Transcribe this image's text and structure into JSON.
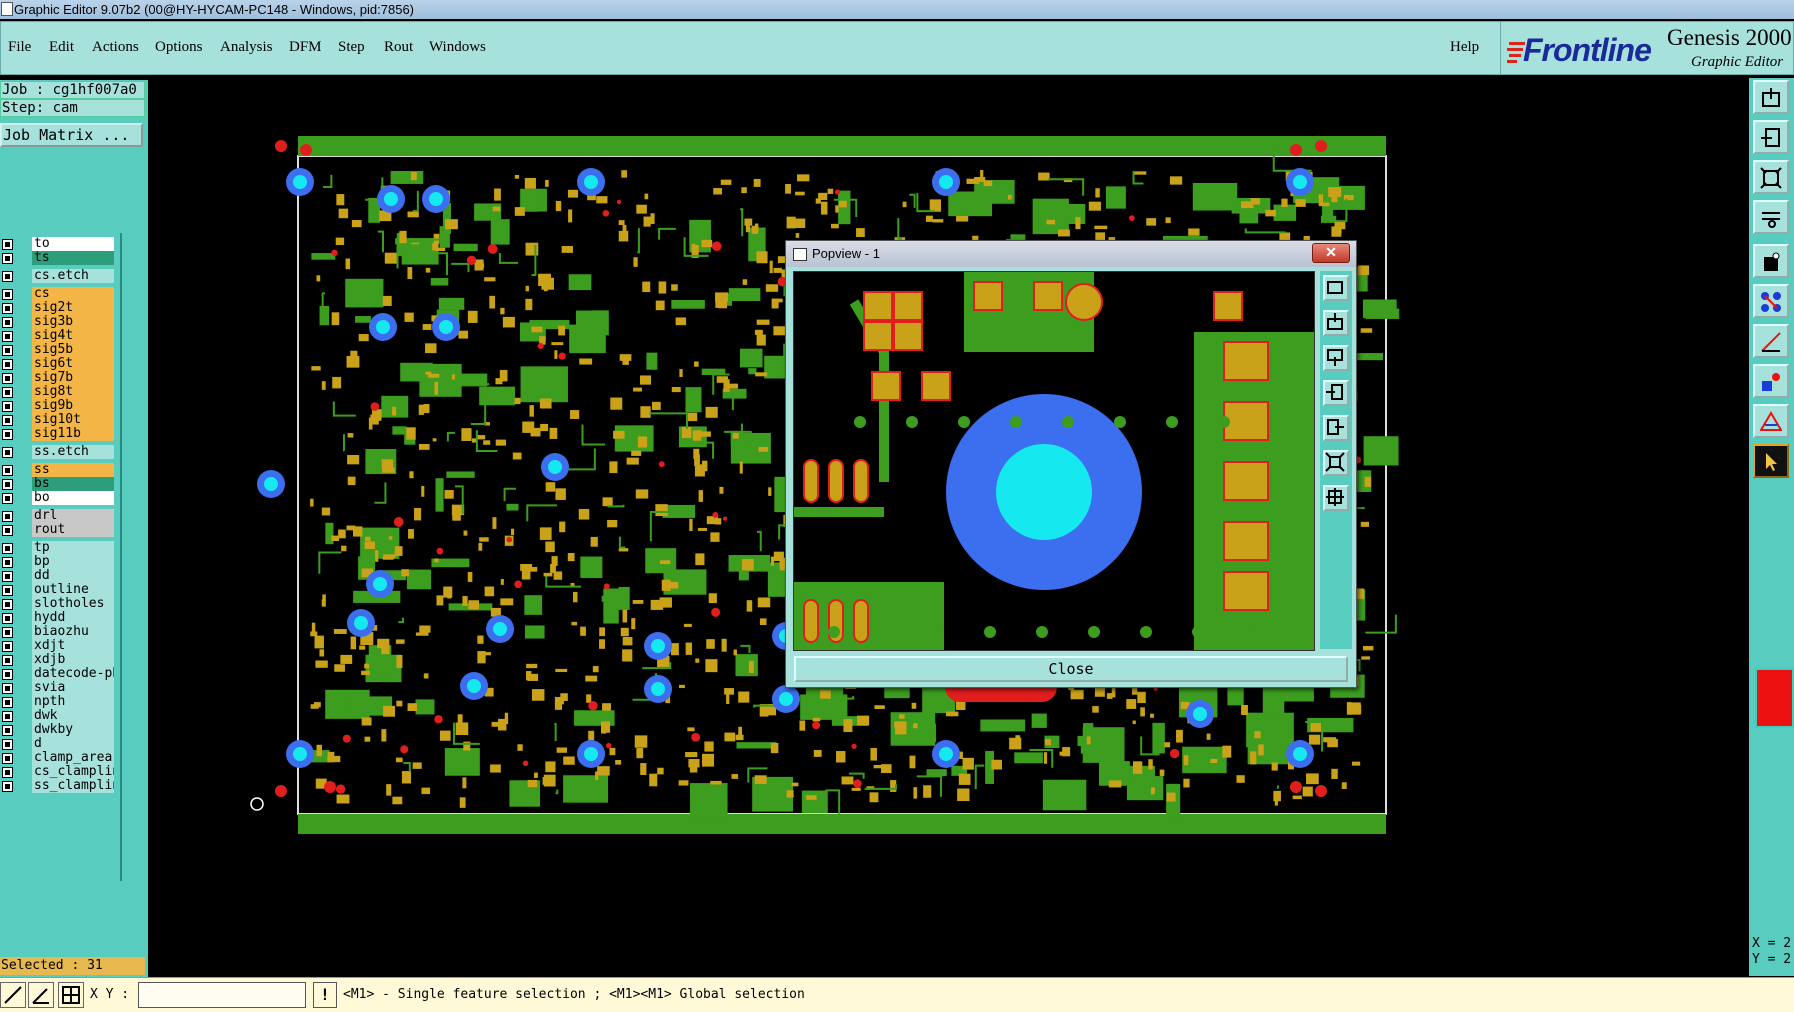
{
  "window": {
    "title": "Graphic Editor 9.07b2 (00@HY-HYCAM-PC148 - Windows, pid:7856)"
  },
  "menu": {
    "items": [
      "File",
      "Edit",
      "Actions",
      "Options",
      "Analysis",
      "DFM",
      "Step",
      "Rout",
      "Windows"
    ],
    "help": "Help"
  },
  "brand": {
    "logo": "Frontline",
    "product": "Genesis 2000",
    "subtitle": "Graphic Editor"
  },
  "job": {
    "job_line": "Job : cg1hf007a0",
    "step_line": "Step: cam",
    "matrix_button": "Job Matrix ..."
  },
  "layers": [
    {
      "name": "to",
      "color": "#ffffff"
    },
    {
      "name": "ts",
      "color": "#2e9d7c"
    },
    {
      "name": "cs.etch",
      "color": "#a7e1dc"
    },
    {
      "name": "cs",
      "color": "#f3b545"
    },
    {
      "name": "sig2t",
      "color": "#f3b545"
    },
    {
      "name": "sig3b",
      "color": "#f3b545"
    },
    {
      "name": "sig4t",
      "color": "#f3b545"
    },
    {
      "name": "sig5b",
      "color": "#f3b545"
    },
    {
      "name": "sig6t",
      "color": "#f3b545"
    },
    {
      "name": "sig7b",
      "color": "#f3b545"
    },
    {
      "name": "sig8t",
      "color": "#f3b545"
    },
    {
      "name": "sig9b",
      "color": "#f3b545"
    },
    {
      "name": "sig10t",
      "color": "#f3b545"
    },
    {
      "name": "sig11b",
      "color": "#f3b545"
    },
    {
      "name": "ss.etch",
      "color": "#a7e1dc"
    },
    {
      "name": "ss",
      "color": "#f3b545"
    },
    {
      "name": "bs",
      "color": "#2e9d7c"
    },
    {
      "name": "bo",
      "color": "#ffffff"
    },
    {
      "name": "drl",
      "color": "#c8c8c8"
    },
    {
      "name": "rout",
      "color": "#c8c8c8"
    },
    {
      "name": "tp",
      "color": "#a7e1dc"
    },
    {
      "name": "bp",
      "color": "#a7e1dc"
    },
    {
      "name": "dd",
      "color": "#a7e1dc"
    },
    {
      "name": "outline",
      "color": "#a7e1dc"
    },
    {
      "name": "slotholes",
      "color": "#a7e1dc"
    },
    {
      "name": "hydd",
      "color": "#a7e1dc"
    },
    {
      "name": "biaozhu",
      "color": "#a7e1dc"
    },
    {
      "name": "xdjt",
      "color": "#a7e1dc"
    },
    {
      "name": "xdjb",
      "color": "#a7e1dc"
    },
    {
      "name": "datecode-pbe",
      "color": "#a7e1dc"
    },
    {
      "name": "svia",
      "color": "#a7e1dc"
    },
    {
      "name": "npth",
      "color": "#a7e1dc"
    },
    {
      "name": "dwk",
      "color": "#a7e1dc"
    },
    {
      "name": "dwkby",
      "color": "#a7e1dc"
    },
    {
      "name": "d",
      "color": "#a7e1dc"
    },
    {
      "name": "clamp_area",
      "color": "#a7e1dc"
    },
    {
      "name": "cs_clampline",
      "color": "#a7e1dc"
    },
    {
      "name": "ss_clampline",
      "color": "#a7e1dc"
    }
  ],
  "selection": {
    "selected_text": "Selected : 31"
  },
  "statusbar": {
    "xy_label": "X Y :",
    "xy_value": "",
    "excl": "!",
    "hint": "<M1> - Single feature selection ; <M1><M1> Global selection"
  },
  "coords": {
    "x_label": "X = 2",
    "y_label": "Y = 2"
  },
  "popview": {
    "title": "Popview - 1",
    "close_x": "✕",
    "close_button": "Close"
  },
  "colors": {
    "board_green": "#3c9d1e",
    "copper": "#c9a21a",
    "pad_red": "#e11e1e",
    "via_blue": "#3c6ef0",
    "via_cyan": "#16e8f0"
  }
}
